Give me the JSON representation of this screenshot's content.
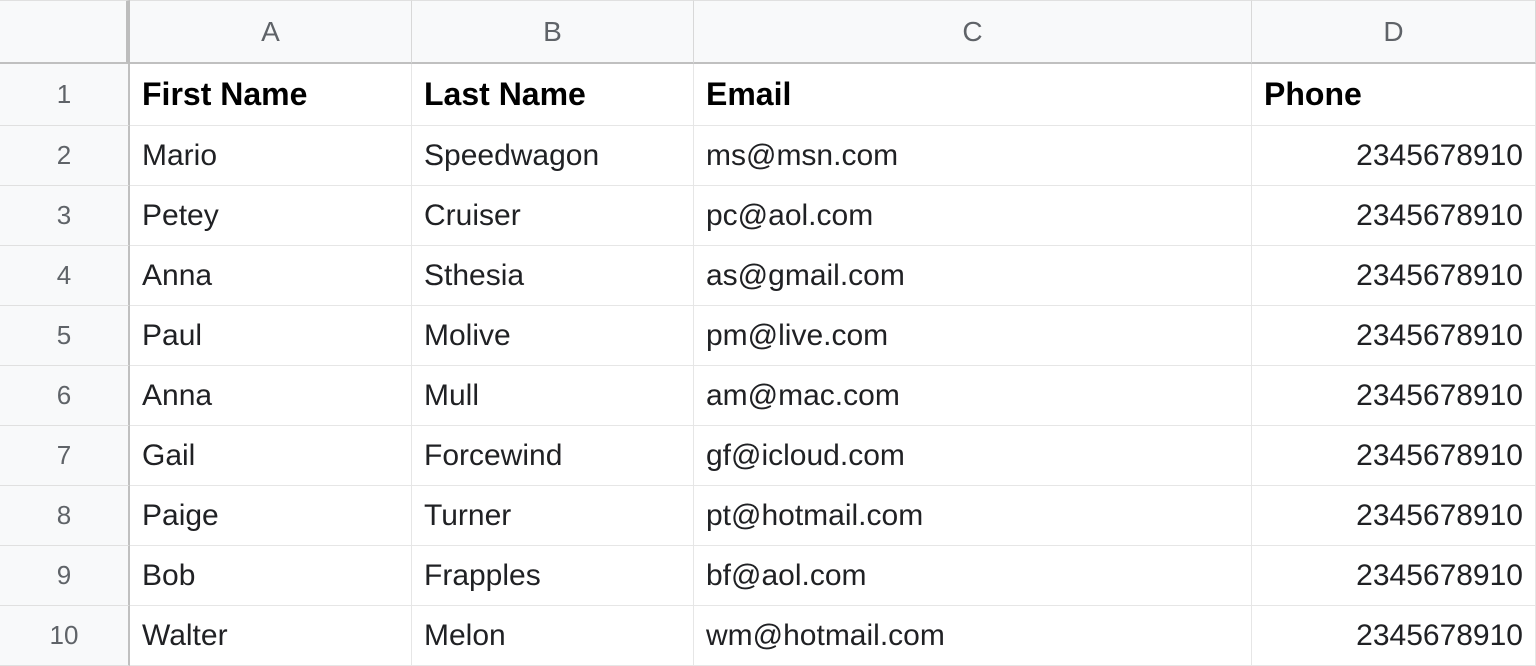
{
  "columns": [
    "A",
    "B",
    "C",
    "D"
  ],
  "rowNumbers": [
    "1",
    "2",
    "3",
    "4",
    "5",
    "6",
    "7",
    "8",
    "9",
    "10"
  ],
  "headers": {
    "A": "First Name",
    "B": "Last Name",
    "C": "Email",
    "D": "Phone"
  },
  "rows": [
    {
      "A": "Mario",
      "B": "Speedwagon",
      "C": "ms@msn.com",
      "D": "2345678910"
    },
    {
      "A": "Petey",
      "B": "Cruiser",
      "C": "pc@aol.com",
      "D": "2345678910"
    },
    {
      "A": "Anna",
      "B": "Sthesia",
      "C": "as@gmail.com",
      "D": "2345678910"
    },
    {
      "A": "Paul",
      "B": "Molive",
      "C": "pm@live.com",
      "D": "2345678910"
    },
    {
      "A": "Anna",
      "B": "Mull",
      "C": "am@mac.com",
      "D": "2345678910"
    },
    {
      "A": "Gail",
      "B": "Forcewind",
      "C": "gf@icloud.com",
      "D": "2345678910"
    },
    {
      "A": "Paige",
      "B": "Turner",
      "C": "pt@hotmail.com",
      "D": "2345678910"
    },
    {
      "A": "Bob",
      "B": "Frapples",
      "C": "bf@aol.com",
      "D": "2345678910"
    },
    {
      "A": "Walter",
      "B": "Melon",
      "C": "wm@hotmail.com",
      "D": "2345678910"
    }
  ]
}
